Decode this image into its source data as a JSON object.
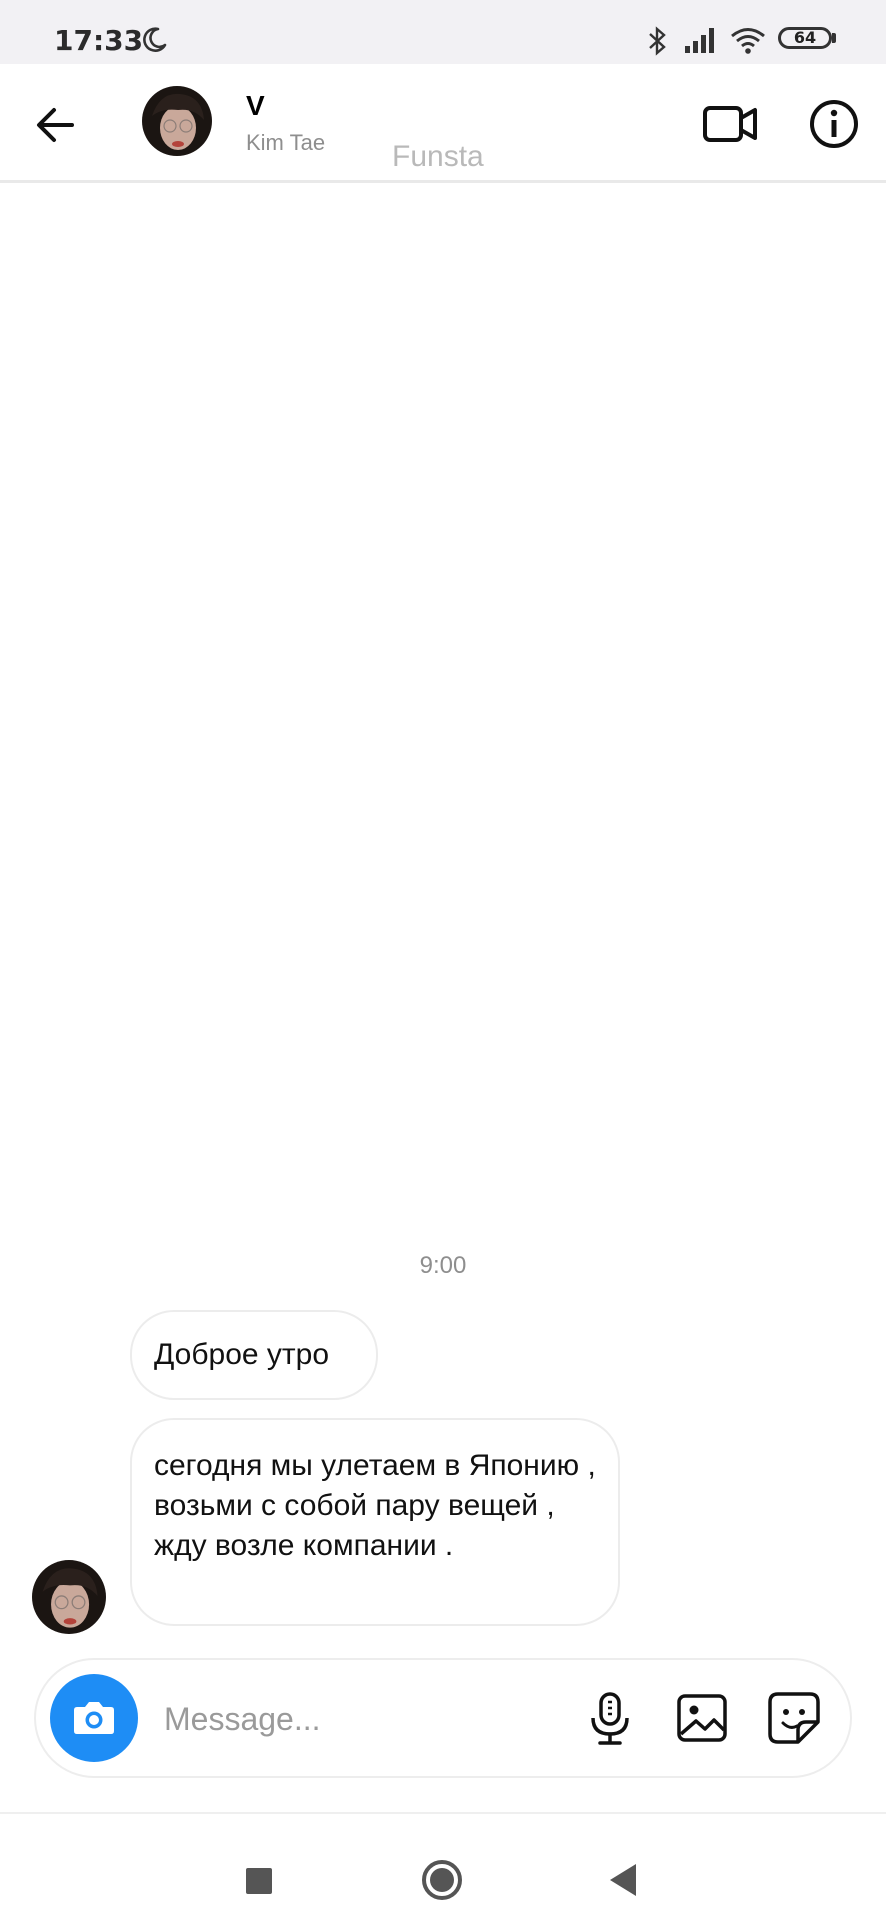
{
  "status_bar": {
    "time": "17:33",
    "battery": "64",
    "icons": [
      "moon-icon",
      "bluetooth-icon",
      "signal-icon",
      "wifi-icon",
      "battery-icon"
    ]
  },
  "header": {
    "contact_name": "V",
    "contact_username": "Kim Tae",
    "watermark": "Funsta",
    "icons": [
      "back-arrow-icon",
      "video-call-icon",
      "info-icon"
    ]
  },
  "messages": {
    "timestamp": "9:00",
    "items": [
      {
        "text": "Доброе утро",
        "from": "contact"
      },
      {
        "text": "сегодня мы улетаем в Японию , возьми с собой пару вещей , жду возле компании .",
        "from": "contact"
      }
    ]
  },
  "composer": {
    "placeholder": "Message...",
    "icons": [
      "camera-icon",
      "microphone-icon",
      "gallery-icon",
      "sticker-icon"
    ]
  },
  "nav_bar": {
    "icons": [
      "recents-square-icon",
      "home-circle-icon",
      "back-triangle-icon"
    ]
  },
  "colors": {
    "accent": "#1e8df5",
    "status_bar_bg": "#f2f1f4",
    "bubble_border": "#ececec",
    "muted_text": "#8e8e8e"
  }
}
